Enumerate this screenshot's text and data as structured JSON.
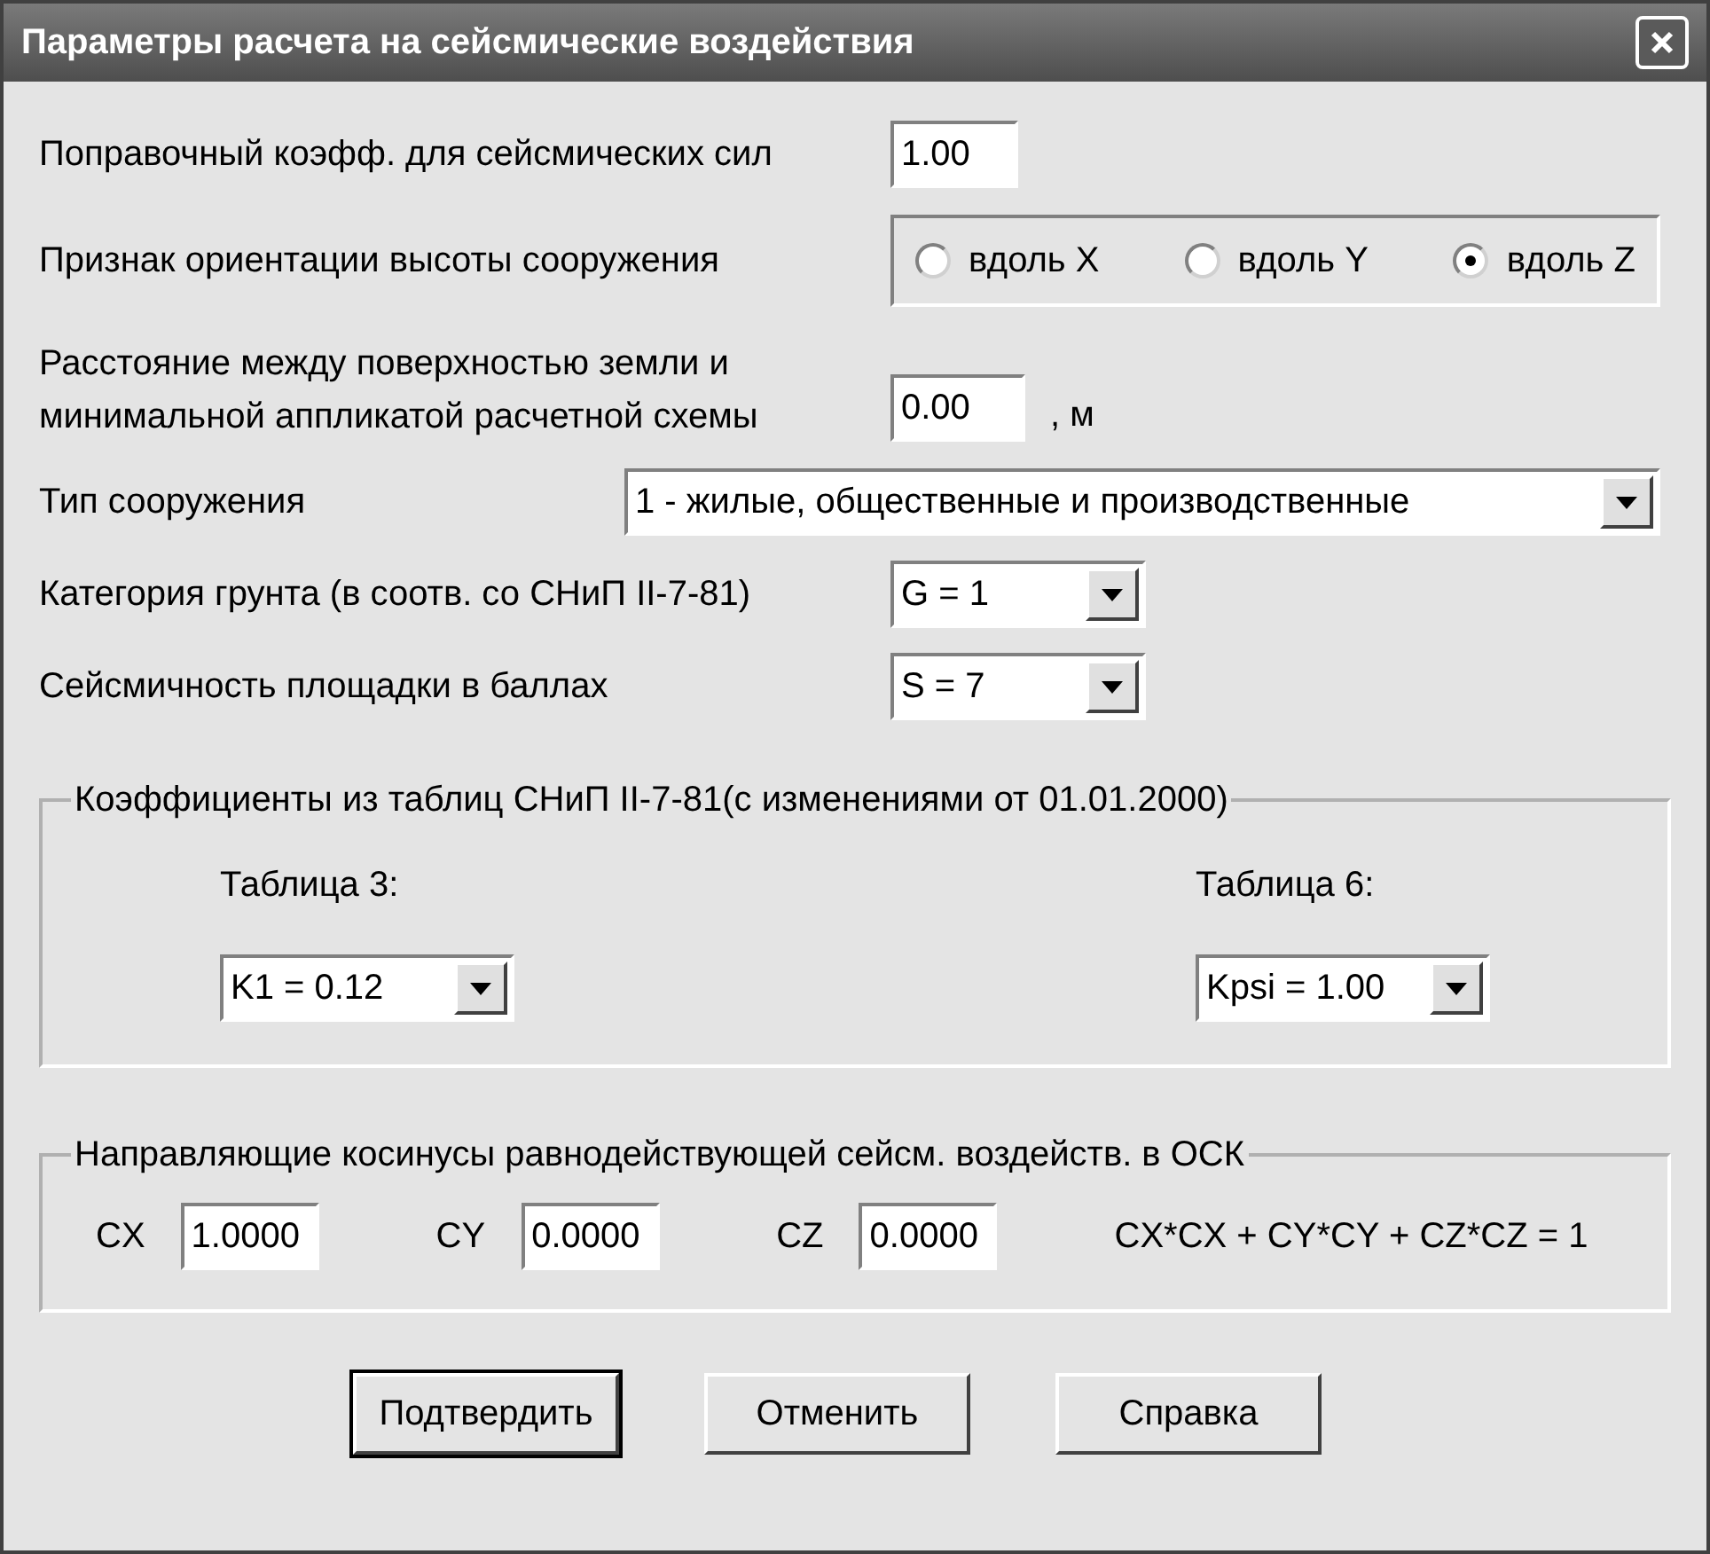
{
  "window": {
    "title": "Параметры расчета на сейсмические воздействия"
  },
  "correction": {
    "label": "Поправочный коэфф. для сейсмических сил",
    "value": "1.00"
  },
  "orientation": {
    "label": "Признак ориентации высоты сооружения",
    "options": [
      {
        "label": "вдоль X",
        "selected": false
      },
      {
        "label": "вдоль Y",
        "selected": false
      },
      {
        "label": "вдоль Z",
        "selected": true
      }
    ]
  },
  "distance": {
    "label_lines": [
      "Расстояние между поверхностью земли и",
      "минимальной аппликатой расчетной схемы"
    ],
    "value": "0.00",
    "unit": ", м"
  },
  "structure_type": {
    "label": "Тип сооружения",
    "value": "1 - жилые, общественные и производственные"
  },
  "soil": {
    "label": "Категория грунта (в соотв. со СНиП II-7-81)",
    "value": "G = 1"
  },
  "seismicity": {
    "label": "Сейсмичность площадки в баллах",
    "value": "S = 7"
  },
  "coefficients": {
    "title": "Коэффициенты из таблиц СНиП II-7-81(с изменениями от 01.01.2000)",
    "tables": [
      {
        "label": "Таблица 3:",
        "value": "K1 = 0.12"
      },
      {
        "label": "Таблица 6:",
        "value": "Kpsi = 1.00"
      }
    ]
  },
  "cosines": {
    "title": "Направляющие косинусы равнодействующей сейсм. воздейств. в ОСК",
    "items": [
      {
        "label": "CX",
        "value": "1.0000"
      },
      {
        "label": "CY",
        "value": "0.0000"
      },
      {
        "label": "CZ",
        "value": "0.0000"
      }
    ],
    "formula": "CX*CX + CY*CY + CZ*CZ = 1"
  },
  "buttons": [
    {
      "label": "Подтвердить",
      "default": true
    },
    {
      "label": "Отменить",
      "default": false
    },
    {
      "label": "Справка",
      "default": false
    }
  ]
}
